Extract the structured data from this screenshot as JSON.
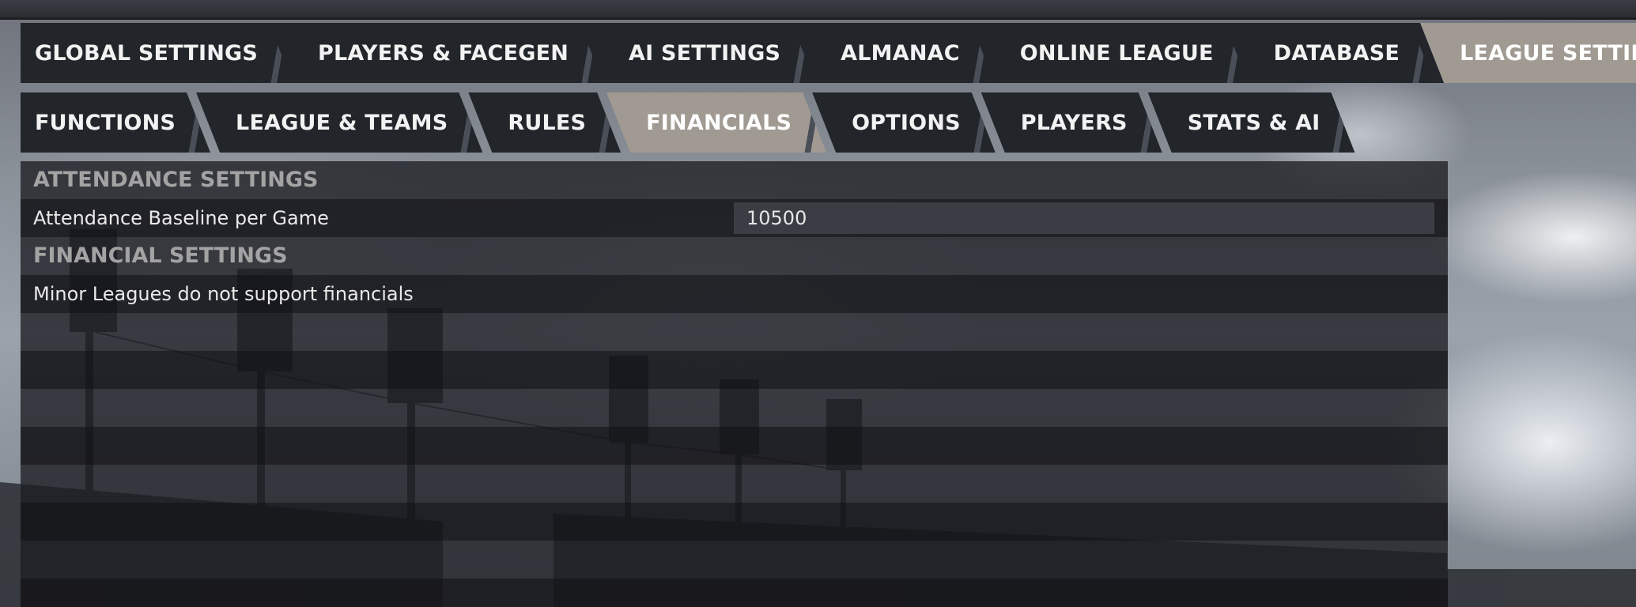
{
  "tabs_primary": [
    {
      "label": "GLOBAL SETTINGS",
      "active": false
    },
    {
      "label": "PLAYERS & FACEGEN",
      "active": false
    },
    {
      "label": "AI SETTINGS",
      "active": false
    },
    {
      "label": "ALMANAC",
      "active": false
    },
    {
      "label": "ONLINE LEAGUE",
      "active": false
    },
    {
      "label": "DATABASE",
      "active": false
    },
    {
      "label": "LEAGUE SETTINGS",
      "active": true
    }
  ],
  "tabs_secondary": [
    {
      "label": "FUNCTIONS",
      "active": false
    },
    {
      "label": "LEAGUE & TEAMS",
      "active": false
    },
    {
      "label": "RULES",
      "active": false
    },
    {
      "label": "FINANCIALS",
      "active": true
    },
    {
      "label": "OPTIONS",
      "active": false
    },
    {
      "label": "PLAYERS",
      "active": false
    },
    {
      "label": "STATS & AI",
      "active": false
    }
  ],
  "attendance": {
    "header": "ATTENDANCE SETTINGS",
    "baseline_label": "Attendance Baseline per Game",
    "baseline_value": "10500"
  },
  "financial": {
    "header": "FINANCIAL SETTINGS",
    "note": "Minor Leagues do not support financials"
  },
  "colors": {
    "tab_bg": "#22252a",
    "tab_active_bg": "#a09a92",
    "section_header": "#a3a3a3",
    "text": "#e9e9e9"
  }
}
